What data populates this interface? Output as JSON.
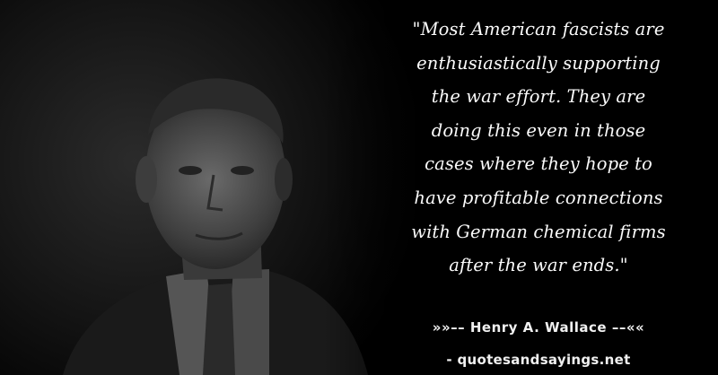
{
  "quote": {
    "text": "\"Most American fascists are enthusiastically supporting the war effort. They are doing this even in those cases where they hope to have profitable connections with German chemical firms after the war ends.\"",
    "lines": [
      "\"Most American fascists are",
      "enthusiastically supporting",
      "the war effort. They are",
      "doing this even in those",
      "cases where they hope to",
      "have profitable connections",
      "with German chemical firms",
      "after the war ends.\""
    ]
  },
  "attribution": {
    "author_line": "»»–– Henry A. Wallace ––««"
  },
  "source": {
    "site_line": "- quotesandsayings.net"
  },
  "colors": {
    "background": "#000000",
    "text": "#fafafa"
  }
}
